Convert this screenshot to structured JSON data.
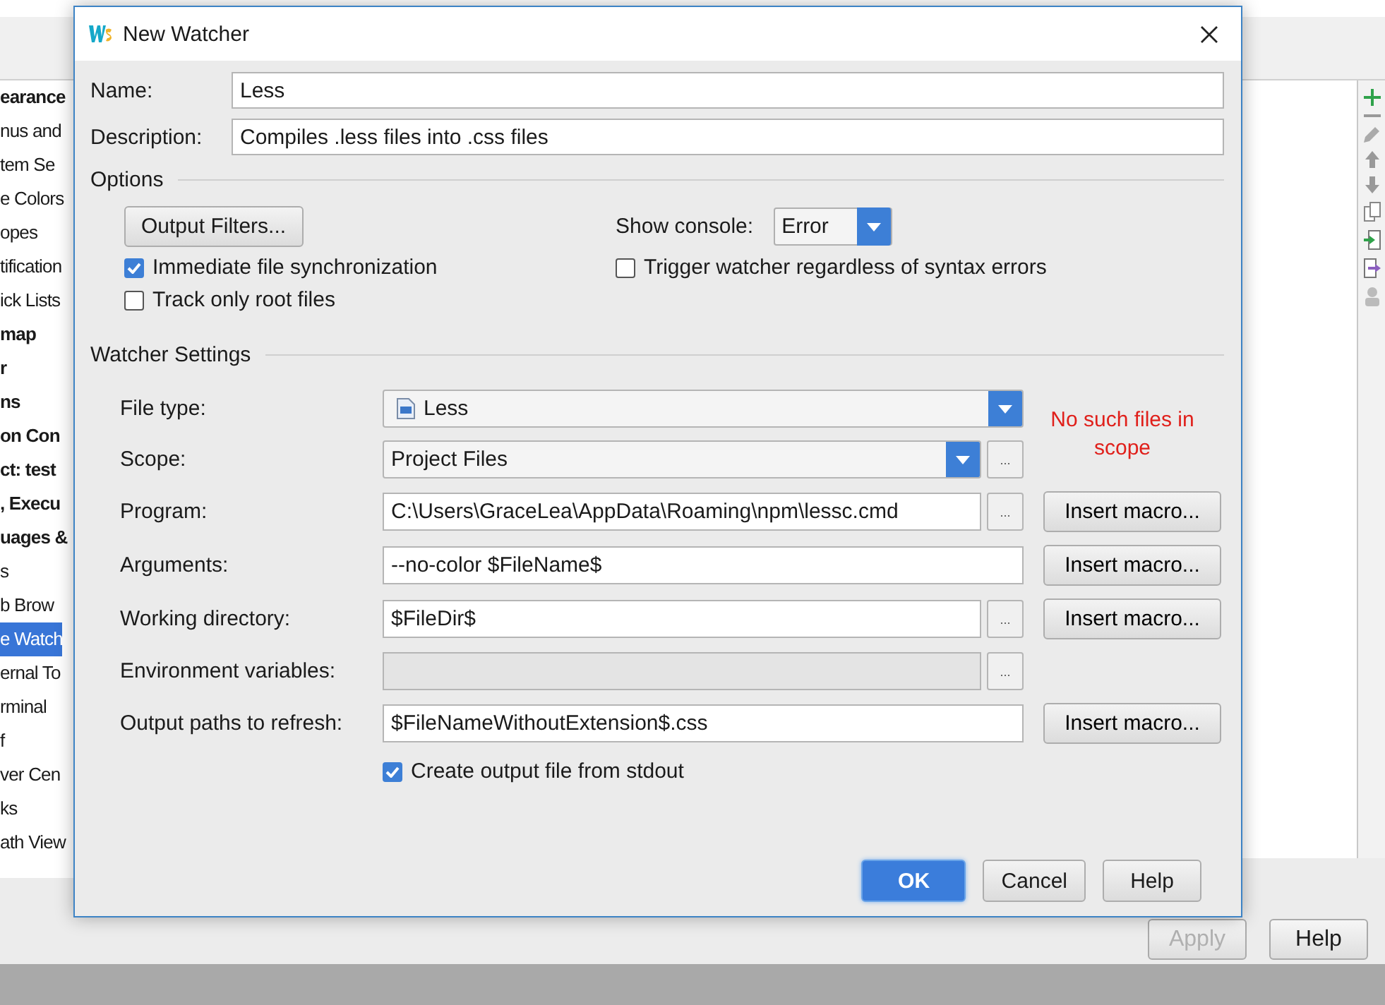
{
  "settings_sidebar": {
    "items": [
      {
        "label": "earance",
        "bold": true,
        "selected": false
      },
      {
        "label": "nus and",
        "bold": false,
        "selected": false
      },
      {
        "label": "tem Se",
        "bold": false,
        "selected": false
      },
      {
        "label": "e Colors",
        "bold": false,
        "selected": false
      },
      {
        "label": "opes",
        "bold": false,
        "selected": false
      },
      {
        "label": "tification",
        "bold": false,
        "selected": false
      },
      {
        "label": "ick Lists",
        "bold": false,
        "selected": false
      },
      {
        "label": "map",
        "bold": true,
        "selected": false
      },
      {
        "label": "r",
        "bold": true,
        "selected": false
      },
      {
        "label": "ns",
        "bold": true,
        "selected": false
      },
      {
        "label": "on Con",
        "bold": true,
        "selected": false
      },
      {
        "label": "ct: test",
        "bold": true,
        "selected": false
      },
      {
        "label": ", Execu",
        "bold": true,
        "selected": false
      },
      {
        "label": "uages &",
        "bold": true,
        "selected": false
      },
      {
        "label": "s",
        "bold": false,
        "selected": false
      },
      {
        "label": "b Brow",
        "bold": false,
        "selected": false
      },
      {
        "label": "e Watch",
        "bold": false,
        "selected": true
      },
      {
        "label": "ernal To",
        "bold": false,
        "selected": false
      },
      {
        "label": "rminal",
        "bold": false,
        "selected": false
      },
      {
        "label": "f",
        "bold": false,
        "selected": false
      },
      {
        "label": "ver Cen",
        "bold": false,
        "selected": false
      },
      {
        "label": "ks",
        "bold": false,
        "selected": false
      },
      {
        "label": "ath View",
        "bold": false,
        "selected": false
      }
    ]
  },
  "settings_buttons": [
    {
      "label": "Apply",
      "disabled": true
    },
    {
      "label": "Help",
      "disabled": false
    }
  ],
  "dialog": {
    "title": "New Watcher",
    "name": {
      "label": "Name:",
      "value": "Less"
    },
    "description": {
      "label": "Description:",
      "value": "Compiles .less files into .css files"
    },
    "options": {
      "title": "Options",
      "filters_button": "Output Filters...",
      "console_label": "Show console:",
      "console_value": "Error",
      "checkboxes": [
        {
          "label": "Immediate file synchronization",
          "checked": true
        },
        {
          "label": "Trigger watcher regardless of syntax errors",
          "checked": false
        },
        {
          "label": "Track only root files",
          "checked": false
        }
      ]
    },
    "watcher_settings": {
      "title": "Watcher Settings",
      "note": "No such files in scope",
      "rows": [
        {
          "label": "File type:",
          "kind": "select",
          "value": "Less",
          "file_icon": true,
          "wide": true
        },
        {
          "label": "Scope:",
          "kind": "select",
          "value": "Project Files",
          "browse": "..."
        },
        {
          "label": "Program:",
          "kind": "text",
          "value": "C:\\Users\\GraceLea\\AppData\\Roaming\\npm\\lessc.cmd",
          "browse": "...",
          "macro": "Insert macro..."
        },
        {
          "label": "Arguments:",
          "kind": "text",
          "value": "--no-color $FileName$",
          "wide": true,
          "macro": "Insert macro..."
        },
        {
          "label": "Working directory:",
          "kind": "text",
          "value": "$FileDir$",
          "browse": "...",
          "macro": "Insert macro..."
        },
        {
          "label": "Environment variables:",
          "kind": "text",
          "disabled": true,
          "browse": "..."
        },
        {
          "label": "Output paths to refresh:",
          "kind": "text",
          "value": "$FileNameWithoutExtension$.css",
          "wide": true,
          "macro": "Insert macro..."
        }
      ],
      "stdout": {
        "label": "Create output file from stdout",
        "checked": true
      }
    },
    "buttons": [
      {
        "label": "OK",
        "primary": true
      },
      {
        "label": "Cancel",
        "primary": false
      },
      {
        "label": "Help",
        "primary": false
      }
    ]
  }
}
